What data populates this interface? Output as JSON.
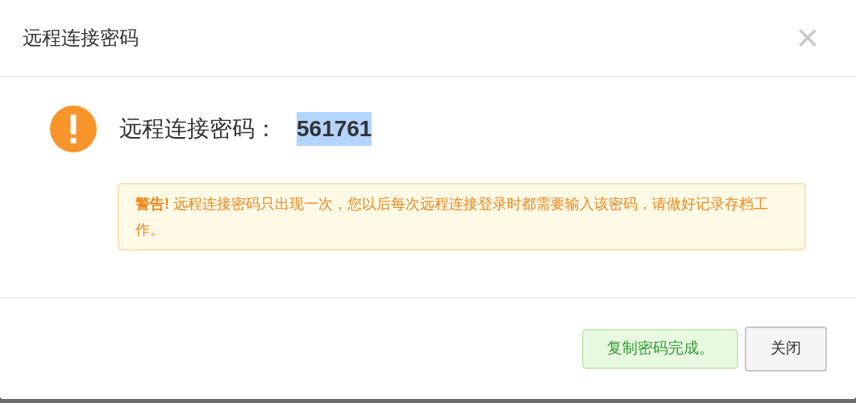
{
  "dialog": {
    "title": "远程连接密码",
    "close_icon": "×"
  },
  "message": {
    "label": "远程连接密码：",
    "password": "561761",
    "password_selected": true
  },
  "warning": "**警告!** 远程连接密码只出现一次，您以后每次远程连接登录时都需要输入该密码，请做好记录存档工作。",
  "footer": {
    "notice": {
      "text": "复制密码完成。",
      "kind": "success"
    },
    "buttons": [
      "关闭"
    ]
  }
}
